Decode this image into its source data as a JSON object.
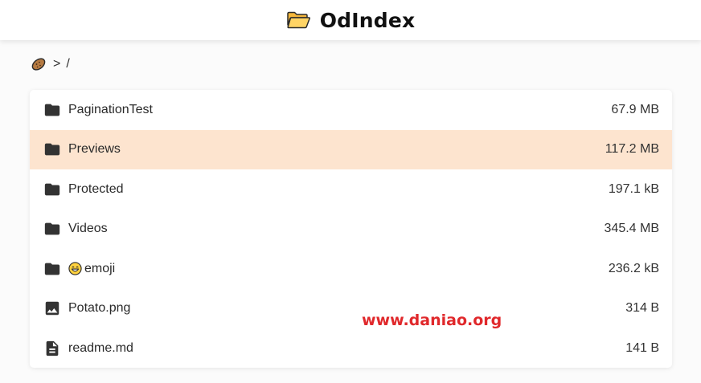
{
  "header": {
    "title": "OdIndex",
    "icon": "folder-open-icon"
  },
  "breadcrumb": {
    "home_icon": "potato-icon",
    "separator": ">",
    "root": "/"
  },
  "files": [
    {
      "name": "PaginationTest",
      "size": "67.9 MB",
      "type": "folder",
      "icon": "folder-icon"
    },
    {
      "name": "Previews",
      "size": "117.2 MB",
      "type": "folder",
      "icon": "folder-icon",
      "highlighted": true
    },
    {
      "name": "Protected",
      "size": "197.1 kB",
      "type": "folder",
      "icon": "folder-icon"
    },
    {
      "name": "Videos",
      "size": "345.4 MB",
      "type": "folder",
      "icon": "folder-icon"
    },
    {
      "name": "emoji",
      "prefix_emoji": "grinning-face-emoji",
      "size": "236.2 kB",
      "type": "folder",
      "icon": "folder-icon"
    },
    {
      "name": "Potato.png",
      "size": "314 B",
      "type": "image",
      "icon": "image-icon"
    },
    {
      "name": "readme.md",
      "size": "141 B",
      "type": "document",
      "icon": "document-icon"
    }
  ],
  "watermark": {
    "text": "www.daniao.org"
  },
  "colors": {
    "highlight_row": "#fde4cf",
    "watermark": "#e0282b",
    "icon": "#333333",
    "folder_brand_fill": "#ffc94d"
  }
}
